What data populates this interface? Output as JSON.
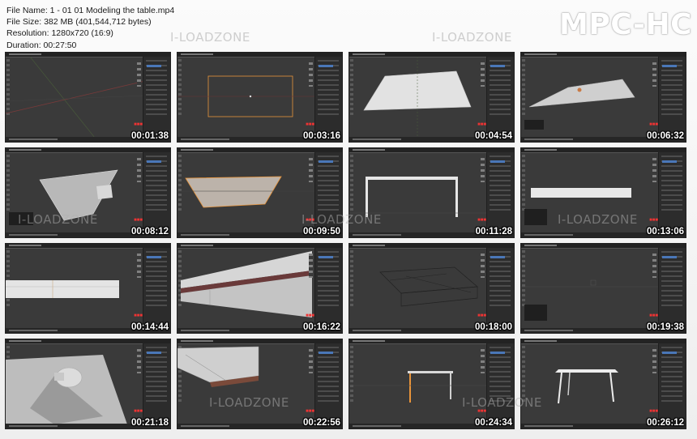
{
  "file_info": {
    "file_name": "File Name: 1 - 01 01 Modeling the table.mp4",
    "file_size": "File Size: 382 MB (401,544,712 bytes)",
    "resolution": "Resolution: 1280x720 (16:9)",
    "duration": "Duration: 00:27:50"
  },
  "logo": "MPC-HC",
  "watermark": "I-LOADZONE",
  "thumbnails": [
    {
      "time": "00:01:38",
      "content": "empty-grid"
    },
    {
      "time": "00:03:16",
      "content": "plane-top-view"
    },
    {
      "time": "00:04:54",
      "content": "white-plane"
    },
    {
      "time": "00:06:32",
      "content": "thin-plane"
    },
    {
      "time": "00:08:12",
      "content": "tilted-slab"
    },
    {
      "time": "00:09:50",
      "content": "beige-slab"
    },
    {
      "time": "00:11:28",
      "content": "frame-front"
    },
    {
      "time": "00:13:06",
      "content": "bar-front"
    },
    {
      "time": "00:14:44",
      "content": "long-bar"
    },
    {
      "time": "00:16:22",
      "content": "perspective-beam"
    },
    {
      "time": "00:18:00",
      "content": "wire-frame"
    },
    {
      "time": "00:19:38",
      "content": "dark-empty"
    },
    {
      "time": "00:21:18",
      "content": "closeup-leg"
    },
    {
      "time": "00:22:56",
      "content": "underside"
    },
    {
      "time": "00:24:34",
      "content": "table-front"
    },
    {
      "time": "00:26:12",
      "content": "table-white"
    }
  ],
  "accent_colors": {
    "selection_orange": "#e8943a",
    "timestamp": "#ffffff",
    "blender_blue": "#4a77b8"
  }
}
